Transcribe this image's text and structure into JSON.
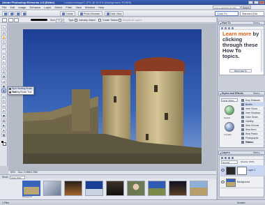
{
  "window": {
    "title": "Adobe Photoshop Elements 4.0 (Editor)",
    "document_path": "Location/Image/7.JPG @ 50.0% (Background, RGB/8)"
  },
  "menu": [
    "File",
    "Edit",
    "Image",
    "Enhance",
    "Layer",
    "Select",
    "Filter",
    "View",
    "Window",
    "Help"
  ],
  "search": {
    "placeholder": "Type a question for help",
    "button": "Search"
  },
  "shortcuts": {
    "buttons": [
      "Create",
      "Photo Browser",
      "Date View"
    ],
    "quick_fix": "Quick Fix",
    "standard_edit": "Standard Edit"
  },
  "options": {
    "size_label": "Size:",
    "size_value": "13 px",
    "type_label": "Type:",
    "intensity": "Intensity: Match",
    "create_texture": "Create Texture",
    "sample_all": "Sample All Layers"
  },
  "tool_flyout": {
    "items": [
      "Spot Healing Brush Tool",
      "Healing Brush Tool"
    ]
  },
  "status": {
    "zoom": "50%",
    "doc_info": "Doc: 2.25M/2.25M"
  },
  "photo_bin": {
    "label": "Show",
    "dropdown": "Open Files",
    "captions": [
      "Background",
      "",
      "",
      "",
      "",
      "",
      "",
      "",
      "",
      ""
    ]
  },
  "bottom_status": {
    "left": "1 Files",
    "right": "Scratch"
  },
  "panels": {
    "howto": {
      "title": "How To",
      "more": "More ▸",
      "text_orange": "Learn more",
      "text_dark": "by clicking through these How To topics.",
      "next_button": "Next How To"
    },
    "styles": {
      "title": "Styles and Effects",
      "more": "More ▸",
      "category": "Layer Styles",
      "swatch_captions": [
        "Default",
        "Complex"
      ],
      "list": [
        "Drop Shadows",
        "Bevels",
        "Inner Glows",
        "Inner Shadows",
        "Outer Glows",
        "Visibility",
        "Wow Chrome",
        "Wow Neon",
        "Wow Plastic",
        "Photographic Effects",
        "Patterns"
      ],
      "selected_index": 1
    },
    "layers": {
      "title": "Layers",
      "more": "More ▸",
      "blend_mode": "Normal",
      "opacity": "Opacity: 100%",
      "items": [
        "Layer 1",
        "Background"
      ],
      "selected_index": 0
    }
  },
  "colors": {
    "title_bar": "#2f53a4",
    "accent": "#3a64c2",
    "howto_orange": "#e55a10",
    "sky": "#2a4fa3",
    "stone": "#b6a475"
  }
}
